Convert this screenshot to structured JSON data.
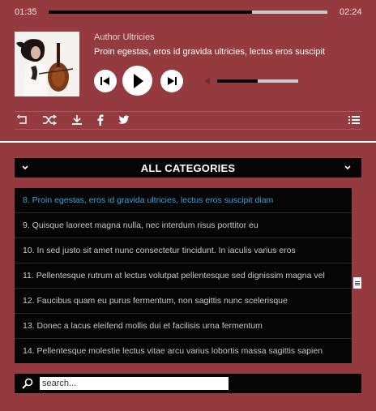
{
  "player": {
    "elapsed": "01:35",
    "duration": "02:24",
    "progress_fraction": 0.73,
    "author": "Author Ultricies",
    "song_title": "Proin egestas, eros id gravida ultricies, lectus eros suscipit",
    "volume_fraction": 0.5,
    "controls": [
      "previous-icon",
      "play-icon",
      "next-icon",
      "volume-icon"
    ]
  },
  "toolbar_icons": [
    "repeat-icon",
    "shuffle-icon",
    "download-icon",
    "facebook-icon",
    "twitter-icon",
    "playlist-icon"
  ],
  "category": {
    "title": "ALL CATEGORIES"
  },
  "playlist": {
    "items": [
      {
        "label": "8. Proin egestas, eros id gravida ultricies, lectus eros suscipit diam",
        "active": true
      },
      {
        "label": "9. Quisque laoreet magna nulla, nec interdum risus porttitor eu",
        "active": false
      },
      {
        "label": "10. In sed justo sit amet nunc consectetur tincidunt. In iaculis varius eros",
        "active": false
      },
      {
        "label": "11. Pellentesque rutrum at lectus volutpat pellentesque sed dignissim magna vel",
        "active": false
      },
      {
        "label": "12. Faucibus quam eu purus fermentum, non sagittis nunc scelerisque",
        "active": false
      },
      {
        "label": "13. Donec a lacus eleifend mollis dui et facilisis urna fermentum",
        "active": false
      },
      {
        "label": "14. Pellentesque molestie lectus vitae arcu varius lobortis massa sagittis sapien",
        "active": false
      }
    ]
  },
  "search": {
    "placeholder": "search..."
  },
  "colors": {
    "background": "#953a3f",
    "panel": "#050505",
    "active_item": "#3ba3e0"
  }
}
